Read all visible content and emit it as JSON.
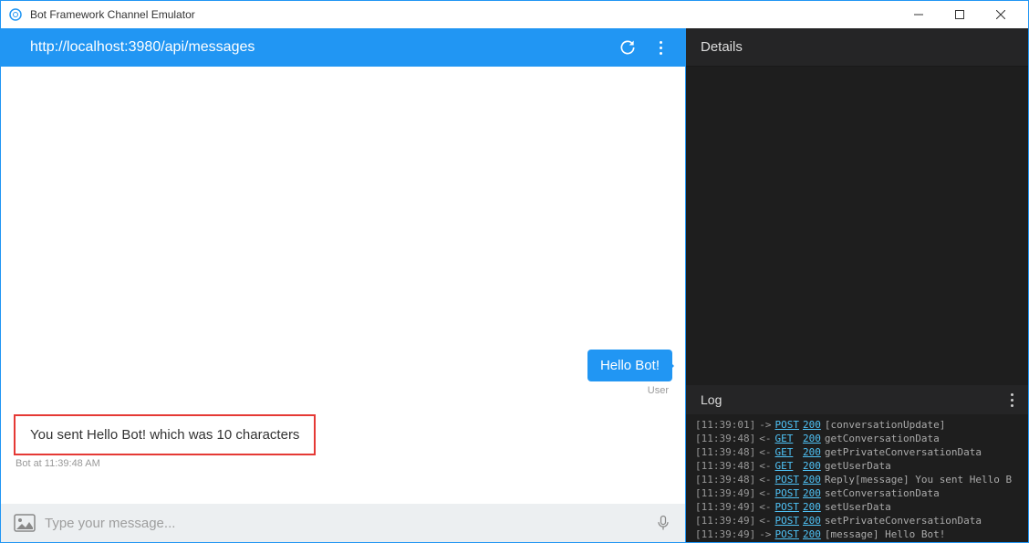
{
  "window": {
    "title": "Bot Framework Channel Emulator"
  },
  "addressBar": {
    "url": "http://localhost:3980/api/messages"
  },
  "chat": {
    "userMessage": "Hello Bot!",
    "userLabel": "User",
    "botMessage": "You sent Hello Bot! which was 10 characters",
    "botLabel": "Bot at 11:39:48 AM"
  },
  "input": {
    "placeholder": "Type your message..."
  },
  "details": {
    "title": "Details"
  },
  "log": {
    "title": "Log",
    "entries": [
      {
        "ts": "[11:39:01]",
        "arrow": "->",
        "method": "POST",
        "code": "200",
        "msg": "[conversationUpdate]"
      },
      {
        "ts": "[11:39:48]",
        "arrow": "<-",
        "method": "GET",
        "code": "200",
        "msg": "getConversationData"
      },
      {
        "ts": "[11:39:48]",
        "arrow": "<-",
        "method": "GET",
        "code": "200",
        "msg": "getPrivateConversationData"
      },
      {
        "ts": "[11:39:48]",
        "arrow": "<-",
        "method": "GET",
        "code": "200",
        "msg": "getUserData"
      },
      {
        "ts": "[11:39:48]",
        "arrow": "<-",
        "method": "POST",
        "code": "200",
        "msg": "Reply[message] You sent Hello B"
      },
      {
        "ts": "[11:39:49]",
        "arrow": "<-",
        "method": "POST",
        "code": "200",
        "msg": "setConversationData"
      },
      {
        "ts": "[11:39:49]",
        "arrow": "<-",
        "method": "POST",
        "code": "200",
        "msg": "setUserData"
      },
      {
        "ts": "[11:39:49]",
        "arrow": "<-",
        "method": "POST",
        "code": "200",
        "msg": "setPrivateConversationData"
      },
      {
        "ts": "[11:39:49]",
        "arrow": "->",
        "method": "POST",
        "code": "200",
        "msg": "[message] Hello Bot!"
      }
    ]
  }
}
